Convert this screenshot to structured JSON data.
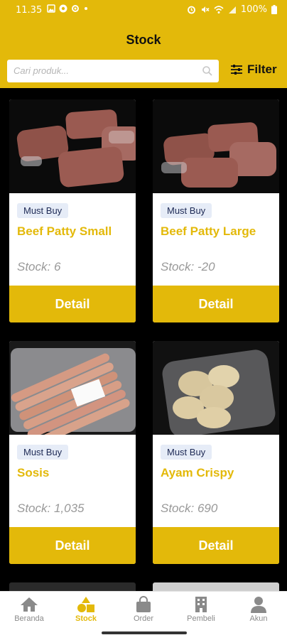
{
  "colors": {
    "accent": "#E3B90A",
    "badge_bg": "#E6ECF7",
    "muted": "#999999",
    "nav_inactive": "#8a8a8a"
  },
  "status_bar": {
    "time": "11.35",
    "battery": "100%"
  },
  "header": {
    "title": "Stock"
  },
  "search": {
    "placeholder": "Cari produk..."
  },
  "filter": {
    "label": "Filter"
  },
  "products": [
    {
      "badge": "Must Buy",
      "name": "Beef Patty Small",
      "stock": "Stock: 6",
      "button": "Detail",
      "image": "raw beef patties in plastic"
    },
    {
      "badge": "Must Buy",
      "name": "Beef Patty Large",
      "stock": "Stock: -20",
      "button": "Detail",
      "image": "raw beef patties in plastic"
    },
    {
      "badge": "Must Buy",
      "name": "Sosis",
      "stock": "Stock: 1,035",
      "button": "Detail",
      "image": "sausages in plastic bag"
    },
    {
      "badge": "Must Buy",
      "name": "Ayam Crispy",
      "stock": "Stock: 690",
      "button": "Detail",
      "image": "breaded chicken patties in plastic bag"
    }
  ],
  "nav": [
    {
      "label": "Beranda",
      "icon": "home-icon"
    },
    {
      "label": "Stock",
      "icon": "shapes-icon",
      "active": true
    },
    {
      "label": "Order",
      "icon": "bag-icon"
    },
    {
      "label": "Pembeli",
      "icon": "building-icon"
    },
    {
      "label": "Akun",
      "icon": "person-icon"
    }
  ]
}
